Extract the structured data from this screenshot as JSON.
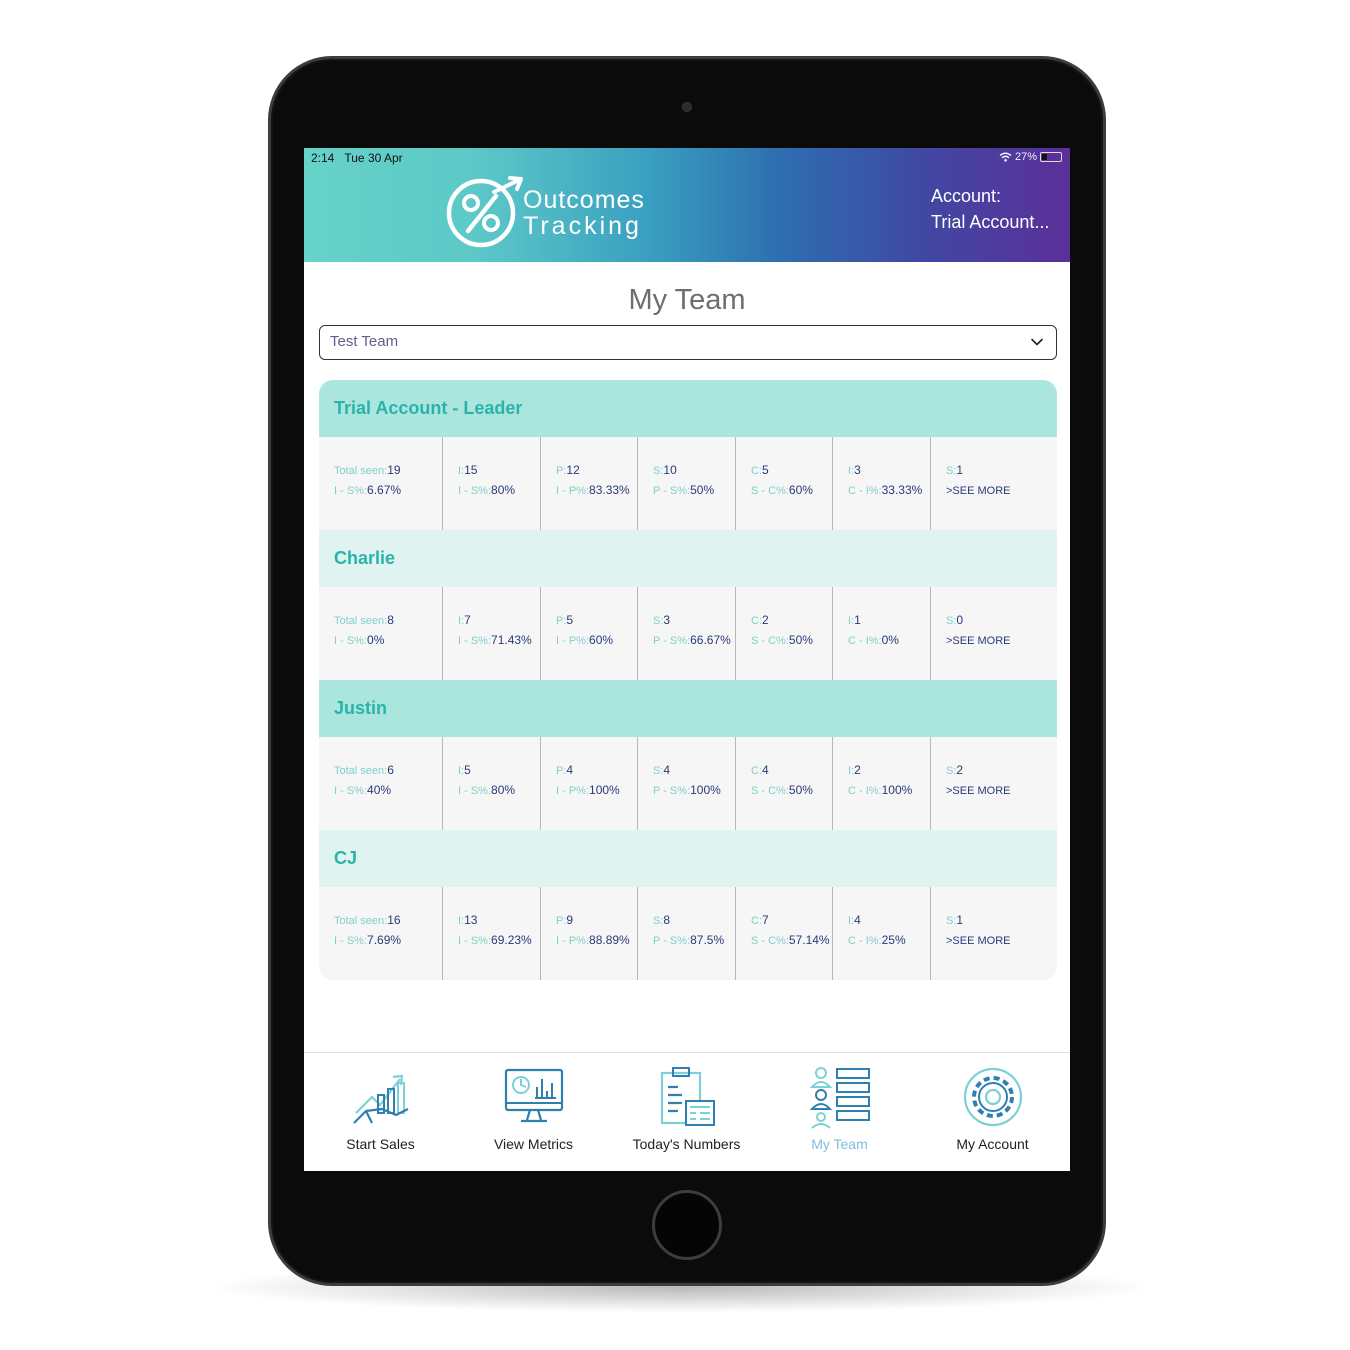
{
  "status_bar": {
    "time": "2:14",
    "date": "Tue 30 Apr",
    "battery": "27%"
  },
  "header": {
    "logo_line1": "Outcomes",
    "logo_line2": "Tracking",
    "account_label": "Account:",
    "account_name": "Trial Account..."
  },
  "page": {
    "title": "My Team"
  },
  "team_select": {
    "value": "Test Team"
  },
  "members": [
    {
      "name": "Trial Account - Leader",
      "stats": [
        {
          "l1": "Total seen:",
          "v1": "19",
          "l2": "I - S%:",
          "v2": "6.67%"
        },
        {
          "l1": "I:",
          "v1": "15",
          "l2": "I - S%:",
          "v2": "80%"
        },
        {
          "l1": "P:",
          "v1": "12",
          "l2": "I - P%:",
          "v2": "83.33%"
        },
        {
          "l1": "S:",
          "v1": "10",
          "l2": "P - S%:",
          "v2": "50%"
        },
        {
          "l1": "C:",
          "v1": "5",
          "l2": "S - C%:",
          "v2": "60%"
        },
        {
          "l1": "I:",
          "v1": "3",
          "l2": "C - I%:",
          "v2": "33.33%"
        },
        {
          "l1": "S:",
          "v1": "1",
          "see_more": ">SEE MORE"
        }
      ]
    },
    {
      "name": "Charlie",
      "stats": [
        {
          "l1": "Total seen:",
          "v1": "8",
          "l2": "I - S%:",
          "v2": "0%"
        },
        {
          "l1": "I:",
          "v1": "7",
          "l2": "I - S%:",
          "v2": "71.43%"
        },
        {
          "l1": "P:",
          "v1": "5",
          "l2": "I - P%:",
          "v2": "60%"
        },
        {
          "l1": "S:",
          "v1": "3",
          "l2": "P - S%:",
          "v2": "66.67%"
        },
        {
          "l1": "C:",
          "v1": "2",
          "l2": "S - C%:",
          "v2": "50%"
        },
        {
          "l1": "I:",
          "v1": "1",
          "l2": "C - I%:",
          "v2": "0%"
        },
        {
          "l1": "S:",
          "v1": "0",
          "see_more": ">SEE MORE"
        }
      ]
    },
    {
      "name": "Justin",
      "stats": [
        {
          "l1": "Total seen:",
          "v1": "6",
          "l2": "I - S%:",
          "v2": "40%"
        },
        {
          "l1": "I:",
          "v1": "5",
          "l2": "I - S%:",
          "v2": "80%"
        },
        {
          "l1": "P:",
          "v1": "4",
          "l2": "I - P%:",
          "v2": "100%"
        },
        {
          "l1": "S:",
          "v1": "4",
          "l2": "P - S%:",
          "v2": "100%"
        },
        {
          "l1": "C:",
          "v1": "4",
          "l2": "S - C%:",
          "v2": "50%"
        },
        {
          "l1": "I:",
          "v1": "2",
          "l2": "C - I%:",
          "v2": "100%"
        },
        {
          "l1": "S:",
          "v1": "2",
          "see_more": ">SEE MORE"
        }
      ]
    },
    {
      "name": "CJ",
      "stats": [
        {
          "l1": "Total seen:",
          "v1": "16",
          "l2": "I - S%:",
          "v2": "7.69%"
        },
        {
          "l1": "I:",
          "v1": "13",
          "l2": "I - S%:",
          "v2": "69.23%"
        },
        {
          "l1": "P:",
          "v1": "9",
          "l2": "I - P%:",
          "v2": "88.89%"
        },
        {
          "l1": "S:",
          "v1": "8",
          "l2": "P - S%:",
          "v2": "87.5%"
        },
        {
          "l1": "C:",
          "v1": "7",
          "l2": "S - C%:",
          "v2": "57.14%"
        },
        {
          "l1": "I:",
          "v1": "4",
          "l2": "C - I%:",
          "v2": "25%"
        },
        {
          "l1": "S:",
          "v1": "1",
          "see_more": ">SEE MORE"
        }
      ]
    }
  ],
  "tabs": [
    {
      "label": "Start Sales",
      "icon": "start-sales-icon"
    },
    {
      "label": "View Metrics",
      "icon": "view-metrics-icon"
    },
    {
      "label": "Today's Numbers",
      "icon": "todays-numbers-icon"
    },
    {
      "label": "My Team",
      "icon": "my-team-icon",
      "active": true
    },
    {
      "label": "My Account",
      "icon": "my-account-icon"
    }
  ],
  "colors": {
    "teal": "#2ab3aa",
    "header_dark": "#abe6de",
    "header_light": "#dff4f1",
    "value_navy": "#2a3a7a",
    "active_tab": "#7dbfe0"
  }
}
